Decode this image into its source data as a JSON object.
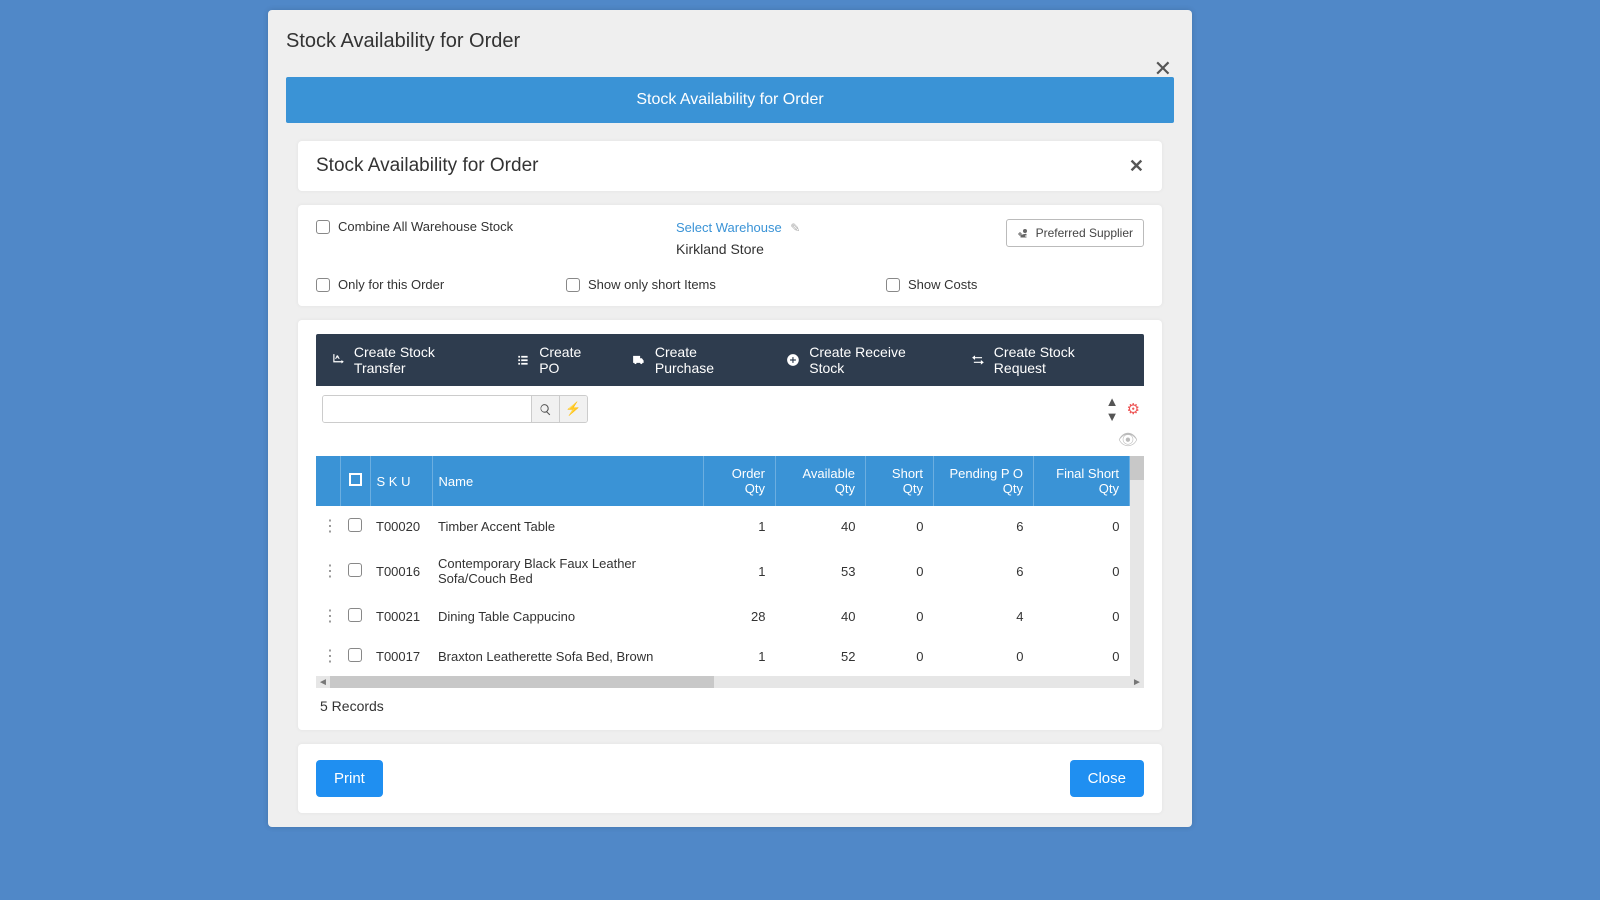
{
  "modal": {
    "title": "Stock Availability for Order",
    "banner": "Stock Availability for Order",
    "panelTitle": "Stock Availability for Order"
  },
  "filters": {
    "combine": "Combine All Warehouse Stock",
    "selectWarehouseLabel": "Select Warehouse",
    "warehouse": "Kirkland Store",
    "supplierBtn": "Preferred Supplier",
    "onlyOrder": "Only for this Order",
    "shortItems": "Show only short Items",
    "showCosts": "Show Costs"
  },
  "actions": {
    "transfer": "Create Stock Transfer",
    "po": "Create PO",
    "purchase": "Create Purchase",
    "receive": "Create Receive Stock",
    "request": "Create Stock Request"
  },
  "columns": [
    "S K U",
    "Name",
    "Order Qty",
    "Available Qty",
    "Short Qty",
    "Pending P O Qty",
    "Final Short Qty"
  ],
  "rows": [
    {
      "sku": "T00020",
      "name": "Timber Accent Table",
      "order": 1,
      "avail": 40,
      "short": 0,
      "pending": 6,
      "final": 0
    },
    {
      "sku": "T00016",
      "name": "Contemporary Black Faux Leather Sofa/Couch Bed",
      "order": 1,
      "avail": 53,
      "short": 0,
      "pending": 6,
      "final": 0
    },
    {
      "sku": "T00021",
      "name": "Dining Table Cappucino",
      "order": 28,
      "avail": 40,
      "short": 0,
      "pending": 4,
      "final": 0
    },
    {
      "sku": "T00017",
      "name": "Braxton Leatherette Sofa Bed, Brown",
      "order": 1,
      "avail": 52,
      "short": 0,
      "pending": 0,
      "final": 0
    }
  ],
  "recordsLabel": "5 Records",
  "buttons": {
    "print": "Print",
    "close": "Close"
  }
}
